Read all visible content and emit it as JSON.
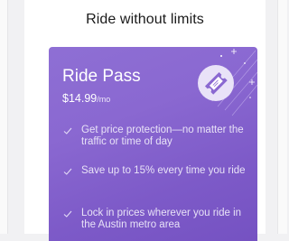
{
  "header": {
    "title": "Ride without limits"
  },
  "card": {
    "title": "Ride Pass",
    "price": "$14.99",
    "price_period": "/mo",
    "icon": "ticket-icon",
    "benefits": [
      {
        "icon": "check-icon",
        "text": "Get price protection—no matter the traffic or time of day"
      },
      {
        "icon": "check-icon",
        "text": "Save up to 15% every time you ride"
      },
      {
        "icon": "check-icon",
        "text": "Lock in prices wherever you ride in the Austin metro area"
      }
    ]
  },
  "colors": {
    "card_gradient_start": "#8e6fd4",
    "card_gradient_end": "#7552c2",
    "text_on_card": "#ffffff"
  }
}
